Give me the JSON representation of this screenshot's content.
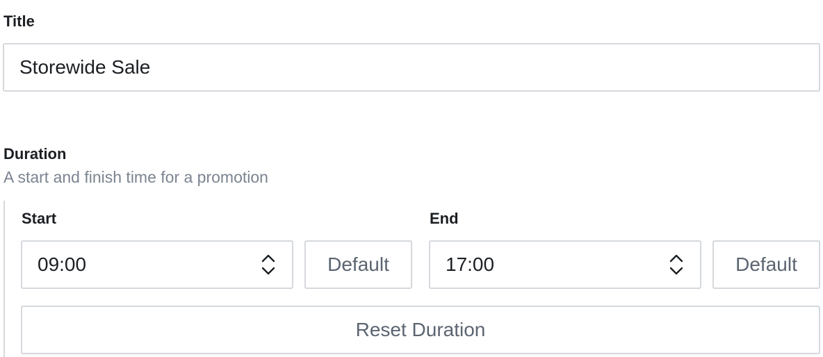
{
  "title_field": {
    "label": "Title",
    "value": "Storewide Sale"
  },
  "duration": {
    "label": "Duration",
    "description": "A start and finish time for a promotion",
    "start": {
      "label": "Start",
      "value": "09:00",
      "icon": "chevron-updown-icon",
      "default_label": "Default"
    },
    "end": {
      "label": "End",
      "value": "17:00",
      "icon": "chevron-updown-icon",
      "default_label": "Default"
    },
    "reset_label": "Reset Duration"
  },
  "colors": {
    "border": "#d5d8dc",
    "text": "#1b1f23",
    "muted_text": "#7b8490",
    "button_text": "#5b6470"
  }
}
